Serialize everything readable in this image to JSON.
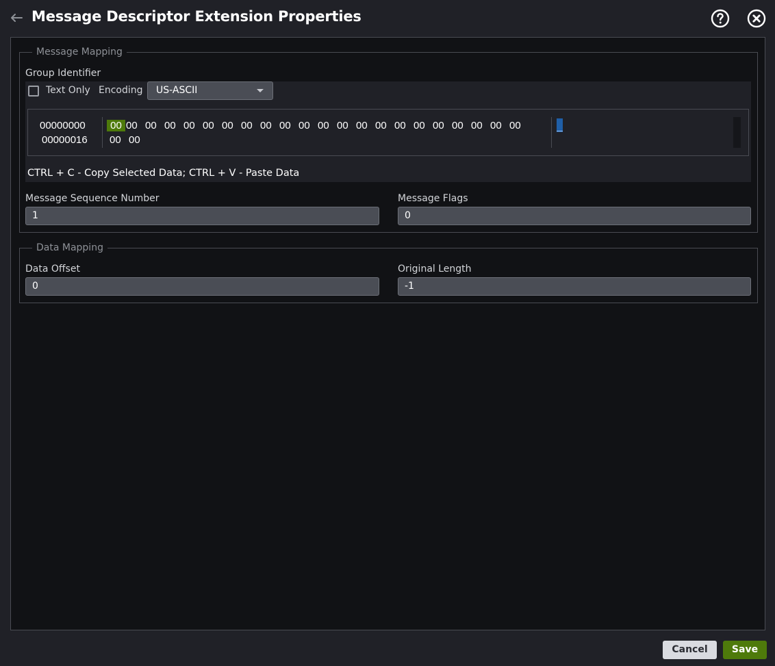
{
  "header": {
    "title": "Message Descriptor Extension Properties",
    "back_icon": "arrow-left-icon",
    "help_icon": "question-circle-icon",
    "close_icon": "close-circle-icon"
  },
  "message_mapping": {
    "legend": "Message Mapping",
    "group_identifier": {
      "label": "Group Identifier",
      "text_only_label": "Text Only",
      "text_only_checked": false,
      "encoding_label": "Encoding",
      "encoding_value": "US-ASCII",
      "hex_editor": {
        "offsets": [
          "00000000",
          "00000016"
        ],
        "rows": [
          [
            "00",
            "00",
            "00",
            "00",
            "00",
            "00",
            "00",
            "00",
            "00",
            "00",
            "00",
            "00",
            "00",
            "00",
            "00",
            "00",
            "00",
            "00",
            "00",
            "00",
            "00",
            "00"
          ],
          [
            "00",
            "00"
          ]
        ],
        "selected_byte_index": 0,
        "hint": "CTRL + C - Copy Selected Data; CTRL + V - Paste Data"
      }
    },
    "sequence_number": {
      "label": "Message Sequence Number",
      "value": "1"
    },
    "flags": {
      "label": "Message Flags",
      "value": "0"
    }
  },
  "data_mapping": {
    "legend": "Data Mapping",
    "data_offset": {
      "label": "Data Offset",
      "value": "0"
    },
    "original_length": {
      "label": "Original Length",
      "value": "-1"
    }
  },
  "footer": {
    "cancel_label": "Cancel",
    "save_label": "Save"
  },
  "colors": {
    "accent_green": "#4e7a0b",
    "background": "#202127",
    "panel": "#111215"
  }
}
